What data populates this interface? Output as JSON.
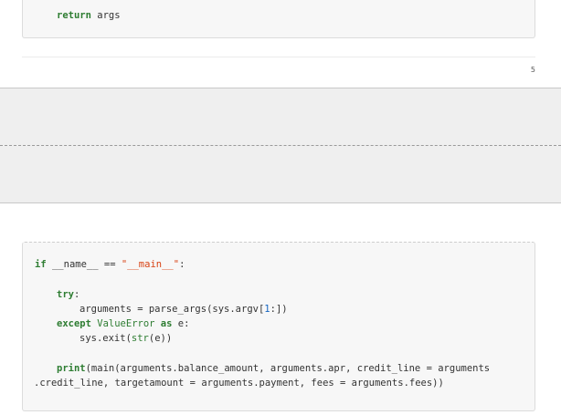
{
  "top_block": {
    "return_kw": "return",
    "return_value": " args"
  },
  "page_footer": {
    "page_number": "5"
  },
  "main_block": {
    "line1": {
      "if_kw": "if",
      "name_part": " __name__ == ",
      "main_str": "\"__main__\"",
      "colon": ":"
    },
    "line2": {
      "try_kw": "try",
      "colon": ":"
    },
    "line3": {
      "prefix": "arguments = parse_args(sys.argv[",
      "num": "1",
      "suffix": ":])"
    },
    "line4": {
      "except_kw": "except",
      "exc_name": " ValueError ",
      "as_kw": "as",
      "rest": " e:"
    },
    "line5": {
      "prefix": "sys.exit(",
      "str_fn": "str",
      "suffix": "(e))"
    },
    "line6": {
      "print_fn": "print",
      "rest": "(main(arguments.balance_amount, arguments.apr, credit_line = arguments"
    },
    "line7": {
      "text": ".credit_line, targetamount = arguments.payment, fees = arguments.fees))"
    }
  }
}
